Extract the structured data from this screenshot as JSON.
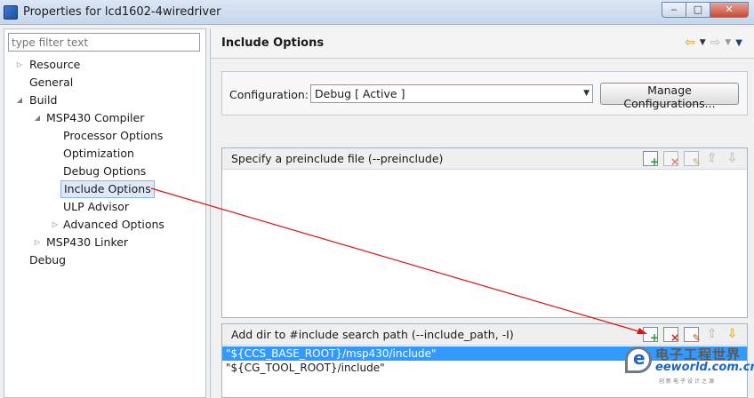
{
  "window": {
    "title": "Properties for lcd1602-4wiredriver",
    "buttons": [
      "‒",
      "□",
      "✕"
    ]
  },
  "filter": {
    "placeholder": "type filter text"
  },
  "tree": [
    {
      "label": "Resource",
      "twisty": "▷"
    },
    {
      "label": "General",
      "twisty": ""
    },
    {
      "label": "Build",
      "twisty": "◢"
    },
    {
      "label": "MSP430 Compiler",
      "twisty": "◢"
    },
    {
      "label": "Processor Options",
      "twisty": ""
    },
    {
      "label": "Optimization",
      "twisty": ""
    },
    {
      "label": "Debug Options",
      "twisty": ""
    },
    {
      "label": "Include Options",
      "twisty": "",
      "selected": true
    },
    {
      "label": "ULP Advisor",
      "twisty": ""
    },
    {
      "label": "Advanced Options",
      "twisty": "▷"
    },
    {
      "label": "MSP430 Linker",
      "twisty": "▷"
    },
    {
      "label": "Debug",
      "twisty": ""
    }
  ],
  "page": {
    "title": "Include Options",
    "nav_icons": [
      "back-arrow-icon",
      "forward-arrow-icon",
      "view-menu-icon"
    ]
  },
  "configuration": {
    "label": "Configuration:",
    "value": "Debug  [ Active ]",
    "manage_button": "Manage Configurations..."
  },
  "preinclude": {
    "title": "Specify a preinclude file (--preinclude)",
    "items": []
  },
  "include_path": {
    "title": "Add dir to #include search path (--include_path, -I)",
    "items": [
      {
        "path": "\"${CCS_BASE_ROOT}/msp430/include\"",
        "selected": true
      },
      {
        "path": "\"${CG_TOOL_ROOT}/include\"",
        "selected": false
      }
    ]
  },
  "watermark": {
    "cn": "电子工程世界",
    "en": "eeworld.com.cn",
    "sub": "创新电子设计之源"
  },
  "colors": {
    "selection": "#3399ff",
    "annotation_arrow": "#e01010"
  }
}
